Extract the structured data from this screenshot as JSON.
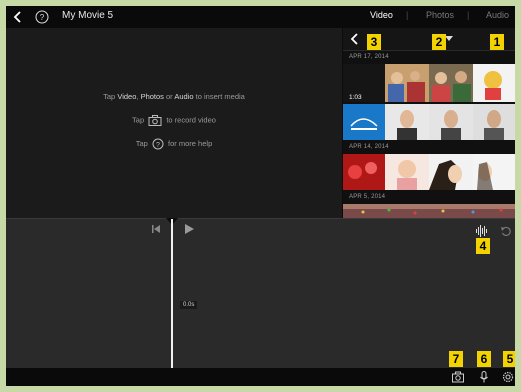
{
  "topbar": {
    "title": "My Movie 5",
    "tabs": [
      "Video",
      "Photos",
      "Audio"
    ],
    "separator": "|"
  },
  "viewer": {
    "insert_prefix": "Tap",
    "insert_video": "Video",
    "insert_sep": ",",
    "insert_photos": "Photos",
    "insert_or": "or",
    "insert_audio": "Audio",
    "insert_suffix": "to insert media",
    "record_prefix": "Tap",
    "record_suffix": "to record video",
    "help_prefix": "Tap",
    "help_suffix": "for more help"
  },
  "browser": {
    "groups": [
      {
        "date": "APR 17, 2014"
      },
      {
        "date": "APR 14, 2014"
      },
      {
        "date": "APR 5, 2014"
      }
    ],
    "duration": "1:03"
  },
  "timeline": {
    "time": "0.0s"
  },
  "badges": [
    "1",
    "2",
    "3",
    "4",
    "5",
    "6",
    "7"
  ],
  "colors": {
    "badge": "#f2d200",
    "frame": "#c8d9a8",
    "active_tab": "#ffffff",
    "inactive_tab": "#7a7a7a"
  }
}
